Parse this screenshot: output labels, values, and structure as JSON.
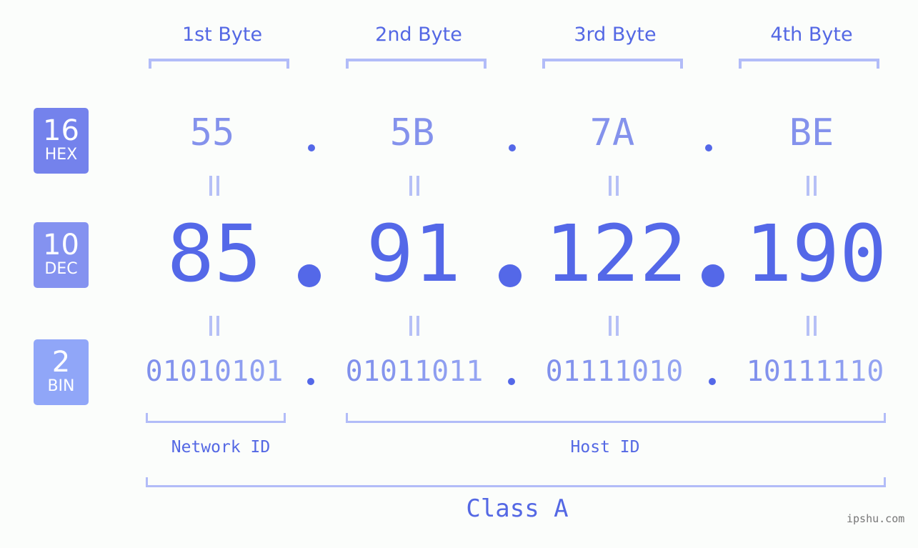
{
  "bytes": {
    "labels": [
      "1st Byte",
      "2nd Byte",
      "3rd Byte",
      "4th Byte"
    ]
  },
  "badges": {
    "hex": {
      "number": "16",
      "label": "HEX",
      "color": "#7482ec"
    },
    "dec": {
      "number": "10",
      "label": "DEC",
      "color": "#8492f0"
    },
    "bin": {
      "number": "2",
      "label": "BIN",
      "color": "#90a6f8"
    }
  },
  "ip": {
    "hex": [
      "55",
      "5B",
      "7A",
      "BE"
    ],
    "dec": [
      "85",
      "91",
      "122",
      "190"
    ],
    "bin": [
      "01010101",
      "01011011",
      "01111010",
      "10111110"
    ]
  },
  "segments": {
    "network_id": "Network ID",
    "host_id": "Host ID",
    "class": "Class A"
  },
  "footer": {
    "site": "ipshu.com"
  }
}
